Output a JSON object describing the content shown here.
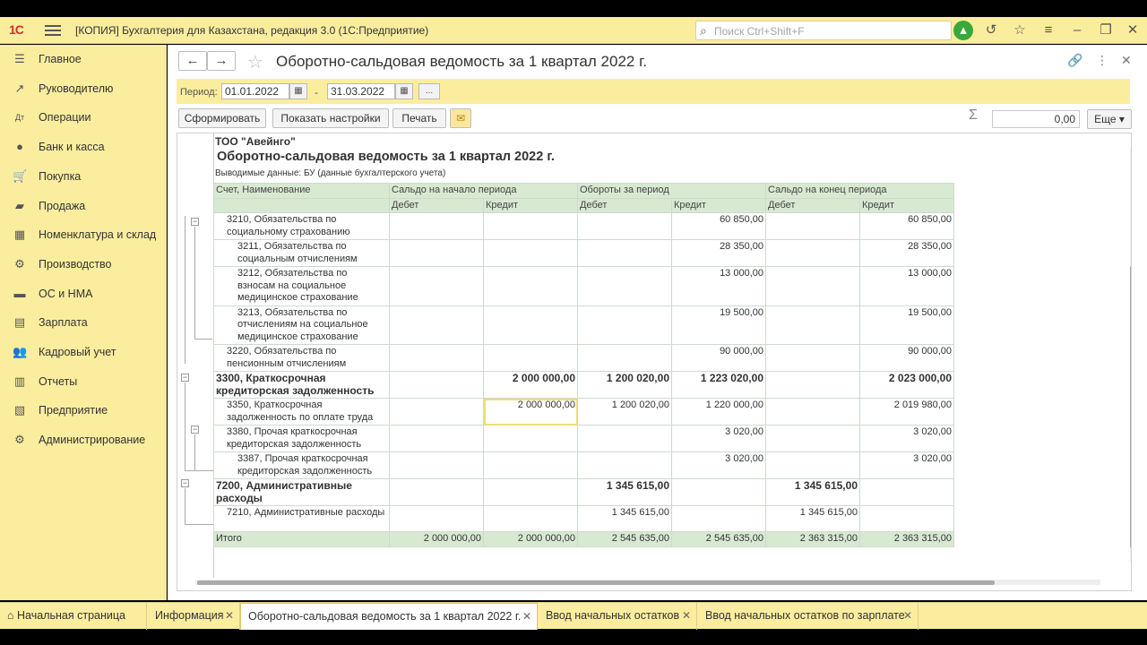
{
  "app": {
    "logo": "1С",
    "title": "[КОПИЯ] Бухгалтерия для Казахстана, редакция 3.0  (1С:Предприятие)",
    "search_placeholder": "Поиск Ctrl+Shift+F"
  },
  "sidebar": {
    "items": [
      {
        "label": "Главное",
        "icon": "menu-icon"
      },
      {
        "label": "Руководителю",
        "icon": "trend-icon"
      },
      {
        "label": "Операции",
        "icon": "operations-icon"
      },
      {
        "label": "Банк и касса",
        "icon": "bank-icon"
      },
      {
        "label": "Покупка",
        "icon": "cart-icon"
      },
      {
        "label": "Продажа",
        "icon": "bag-icon"
      },
      {
        "label": "Номенклатура и склад",
        "icon": "grid-icon"
      },
      {
        "label": "Производство",
        "icon": "factory-icon"
      },
      {
        "label": "ОС и НМА",
        "icon": "assets-icon"
      },
      {
        "label": "Зарплата",
        "icon": "salary-icon"
      },
      {
        "label": "Кадровый учет",
        "icon": "people-icon"
      },
      {
        "label": "Отчеты",
        "icon": "chart-icon"
      },
      {
        "label": "Предприятие",
        "icon": "enterprise-icon"
      },
      {
        "label": "Администрирование",
        "icon": "gear-icon"
      }
    ]
  },
  "form": {
    "title": "Оборотно-сальдовая ведомость  за 1 квартал 2022 г.",
    "period_label": "Период:",
    "date_from": "01.01.2022",
    "date_to": "31.03.2022",
    "dash": "-",
    "more": "...",
    "buttons": {
      "generate": "Сформировать",
      "settings": "Показать настройки",
      "print": "Печать",
      "more": "Еще ▾"
    },
    "sum_value": "0,00"
  },
  "report": {
    "company": "ТОО \"Авейнго\"",
    "title": "Оборотно-сальдовая ведомость  за 1 квартал 2022 г.",
    "subtitle": "Выводимые данные:  БУ (данные бухгалтерского учета)",
    "headers": {
      "account": "Счет, Наименование",
      "start": "Сальдо на начало периода",
      "turnover": "Обороты за период",
      "end": "Сальдо на конец периода",
      "debit": "Дебет",
      "credit": "Кредит"
    },
    "rows": [
      {
        "name": "3210, Обязательства по социальному страхованию",
        "level": 1,
        "bold": false,
        "sd": "",
        "sc": "",
        "td": "",
        "tc": "60 850,00",
        "ed": "",
        "ec": "60 850,00"
      },
      {
        "name": "3211, Обязательства по социальным отчислениям",
        "level": 2,
        "bold": false,
        "sd": "",
        "sc": "",
        "td": "",
        "tc": "28 350,00",
        "ed": "",
        "ec": "28 350,00"
      },
      {
        "name": "3212, Обязательства по взносам на социальное медицинское страхование",
        "level": 2,
        "bold": false,
        "sd": "",
        "sc": "",
        "td": "",
        "tc": "13 000,00",
        "ed": "",
        "ec": "13 000,00"
      },
      {
        "name": "3213, Обязательства по отчислениям на социальное медицинское страхование",
        "level": 2,
        "bold": false,
        "sd": "",
        "sc": "",
        "td": "",
        "tc": "19 500,00",
        "ed": "",
        "ec": "19 500,00"
      },
      {
        "name": "3220, Обязательства по пенсионным отчислениям",
        "level": 1,
        "bold": false,
        "sd": "",
        "sc": "",
        "td": "",
        "tc": "90 000,00",
        "ed": "",
        "ec": "90 000,00"
      },
      {
        "name": "3300, Краткосрочная кредиторская задолженность",
        "level": 0,
        "bold": true,
        "sd": "",
        "sc": "2 000 000,00",
        "td": "1 200 020,00",
        "tc": "1 223 020,00",
        "ed": "",
        "ec": "2 023 000,00"
      },
      {
        "name": "3350, Краткосрочная задолженность по оплате труда",
        "level": 1,
        "bold": false,
        "sd": "",
        "sc": "2 000 000,00",
        "td": "1 200 020,00",
        "tc": "1 220 000,00",
        "ed": "",
        "ec": "2 019 980,00"
      },
      {
        "name": "3380, Прочая краткосрочная кредиторская задолженность",
        "level": 1,
        "bold": false,
        "sd": "",
        "sc": "",
        "td": "",
        "tc": "3 020,00",
        "ed": "",
        "ec": "3 020,00"
      },
      {
        "name": "3387, Прочая краткосрочная кредиторская задолженность",
        "level": 2,
        "bold": false,
        "sd": "",
        "sc": "",
        "td": "",
        "tc": "3 020,00",
        "ed": "",
        "ec": "3 020,00"
      },
      {
        "name": "7200, Административные расходы",
        "level": 0,
        "bold": true,
        "sd": "",
        "sc": "",
        "td": "1 345 615,00",
        "tc": "",
        "ed": "1 345 615,00",
        "ec": ""
      },
      {
        "name": "7210, Административные расходы",
        "level": 1,
        "bold": false,
        "sd": "",
        "sc": "",
        "td": "1 345 615,00",
        "tc": "",
        "ed": "1 345 615,00",
        "ec": ""
      }
    ],
    "total": {
      "name": "Итого",
      "sd": "2 000 000,00",
      "sc": "2 000 000,00",
      "td": "2 545 635,00",
      "tc": "2 545 635,00",
      "ed": "2 363 315,00",
      "ec": "2 363 315,00"
    }
  },
  "tabs": [
    {
      "label": "Начальная страница"
    },
    {
      "label": "Информация"
    },
    {
      "label": "Оборотно-сальдовая ведомость  за 1 квартал 2022 г."
    },
    {
      "label": "Ввод начальных остатков"
    },
    {
      "label": "Ввод начальных остатков по зарплате"
    }
  ],
  "colors": {
    "accent": "#fbed9e",
    "table_header": "#d8e9d2",
    "user": "#3aa73a"
  }
}
